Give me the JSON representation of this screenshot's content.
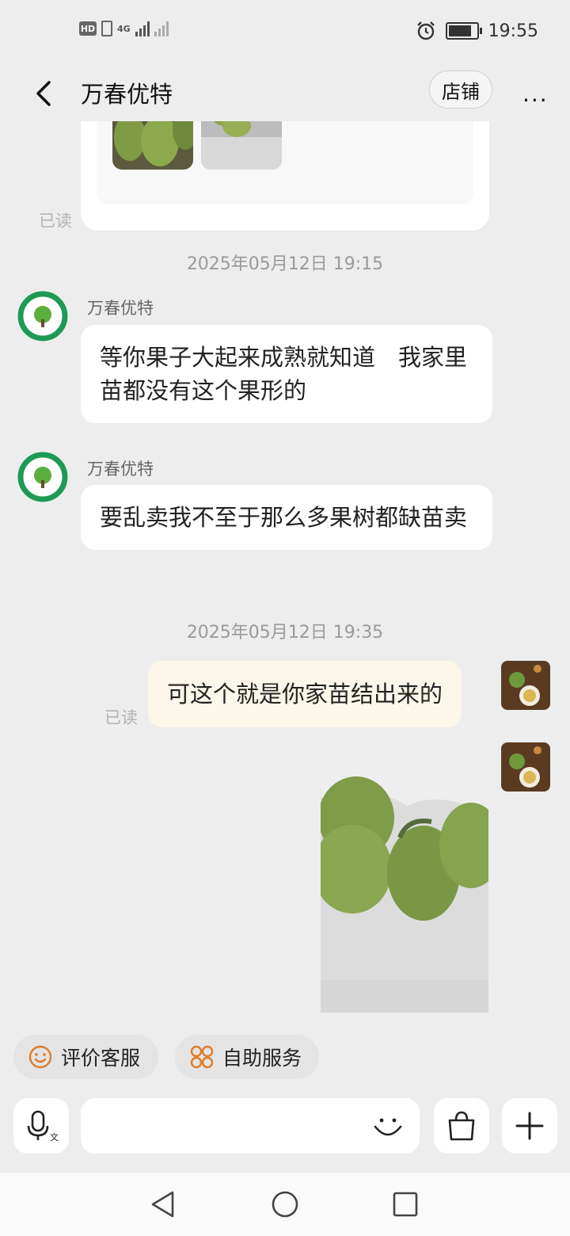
{
  "status": {
    "hd": "HD",
    "network": "4G",
    "time": "19:55"
  },
  "header": {
    "title": "万春优特",
    "shop_label": "店铺",
    "more_label": "···"
  },
  "messages": {
    "prev_read": "已读",
    "ts1": "2025年05月12日 19:15",
    "m1_sender": "万春优特",
    "m1_text": "等你果子大起来成熟就知道　我家里苗都没有这个果形的",
    "m2_sender": "万春优特",
    "m2_text": "要乱卖我不至于那么多果树都缺苗卖",
    "ts2": "2025年05月12日 19:35",
    "m3_text": "可这个就是你家苗结出来的",
    "m3_read": "已读"
  },
  "chips": {
    "rate": "评价客服",
    "self_service": "自助服务"
  },
  "input": {
    "placeholder": ""
  },
  "icons": [
    "back-arrow-icon",
    "voice-icon",
    "emoji-icon",
    "shopping-bag-icon",
    "plus-icon",
    "smile-icon",
    "grid-icon",
    "nav-back-icon",
    "nav-home-icon",
    "nav-recents-icon"
  ]
}
